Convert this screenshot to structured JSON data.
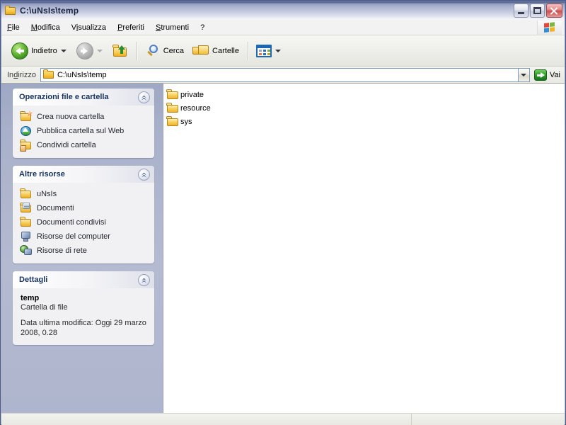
{
  "window": {
    "title": "C:\\uNsIs\\temp",
    "title_icon": "folder-icon",
    "minimize_label": "",
    "maximize_label": "",
    "close_label": ""
  },
  "menubar": {
    "items": [
      {
        "label": "File",
        "accel": "F"
      },
      {
        "label": "Modifica",
        "accel": "M"
      },
      {
        "label": "Visualizza",
        "accel": "V"
      },
      {
        "label": "Preferiti",
        "accel": "P"
      },
      {
        "label": "Strumenti",
        "accel": "S"
      },
      {
        "label": "?",
        "accel": ""
      }
    ],
    "brand_icon": "windows-flag-icon"
  },
  "toolbar": {
    "back_label": "Indietro",
    "back_icon": "back-arrow-icon",
    "forward_label": "",
    "forward_icon": "forward-arrow-icon",
    "up_label": "",
    "up_icon": "up-folder-icon",
    "search_label": "Cerca",
    "search_icon": "search-icon",
    "folders_label": "Cartelle",
    "folders_icon": "folders-icon",
    "views_label": "",
    "views_icon": "views-icon"
  },
  "address": {
    "label": "Indirizzo",
    "accel": "d",
    "value": "C:\\uNsIs\\temp",
    "icon": "folder-icon",
    "dropdown_icon": "chevron-down-icon",
    "go_label": "Vai",
    "go_icon": "go-arrow-icon"
  },
  "sidebar": {
    "panels": [
      {
        "title": "Operazioni file e cartella",
        "collapse_icon": "chevron-up-icon",
        "items": [
          {
            "label": "Crea nuova cartella",
            "icon": "new-folder-icon"
          },
          {
            "label": "Pubblica cartella sul Web",
            "icon": "publish-web-icon"
          },
          {
            "label": "Condividi cartella",
            "icon": "share-folder-icon"
          }
        ]
      },
      {
        "title": "Altre risorse",
        "collapse_icon": "chevron-up-icon",
        "items": [
          {
            "label": "uNsIs",
            "icon": "folder-icon"
          },
          {
            "label": "Documenti",
            "icon": "documents-icon"
          },
          {
            "label": "Documenti condivisi",
            "icon": "shared-documents-icon"
          },
          {
            "label": "Risorse del computer",
            "icon": "my-computer-icon"
          },
          {
            "label": "Risorse di rete",
            "icon": "network-icon"
          }
        ]
      },
      {
        "title": "Dettagli",
        "collapse_icon": "chevron-up-icon",
        "details": {
          "name": "temp",
          "type": "Cartella di file",
          "modified": "Data ultima modifica: Oggi 29 marzo 2008, 0.28"
        }
      }
    ]
  },
  "filelist": {
    "items": [
      {
        "name": "private",
        "icon": "folder-icon"
      },
      {
        "name": "resource",
        "icon": "folder-icon"
      },
      {
        "name": "sys",
        "icon": "folder-icon"
      }
    ]
  },
  "statusbar": {
    "text": ""
  },
  "colors": {
    "title_gradient_top": "#5d6a93",
    "title_gradient_bottom": "#f6f7fa",
    "sidebar_background": "#aab2cb",
    "panel_background": "#f1f1f4",
    "panel_title": "#16325c",
    "folder_yellow": "#f6cd5c",
    "go_green": "#2d9a28",
    "close_red": "#cf4f4f"
  }
}
